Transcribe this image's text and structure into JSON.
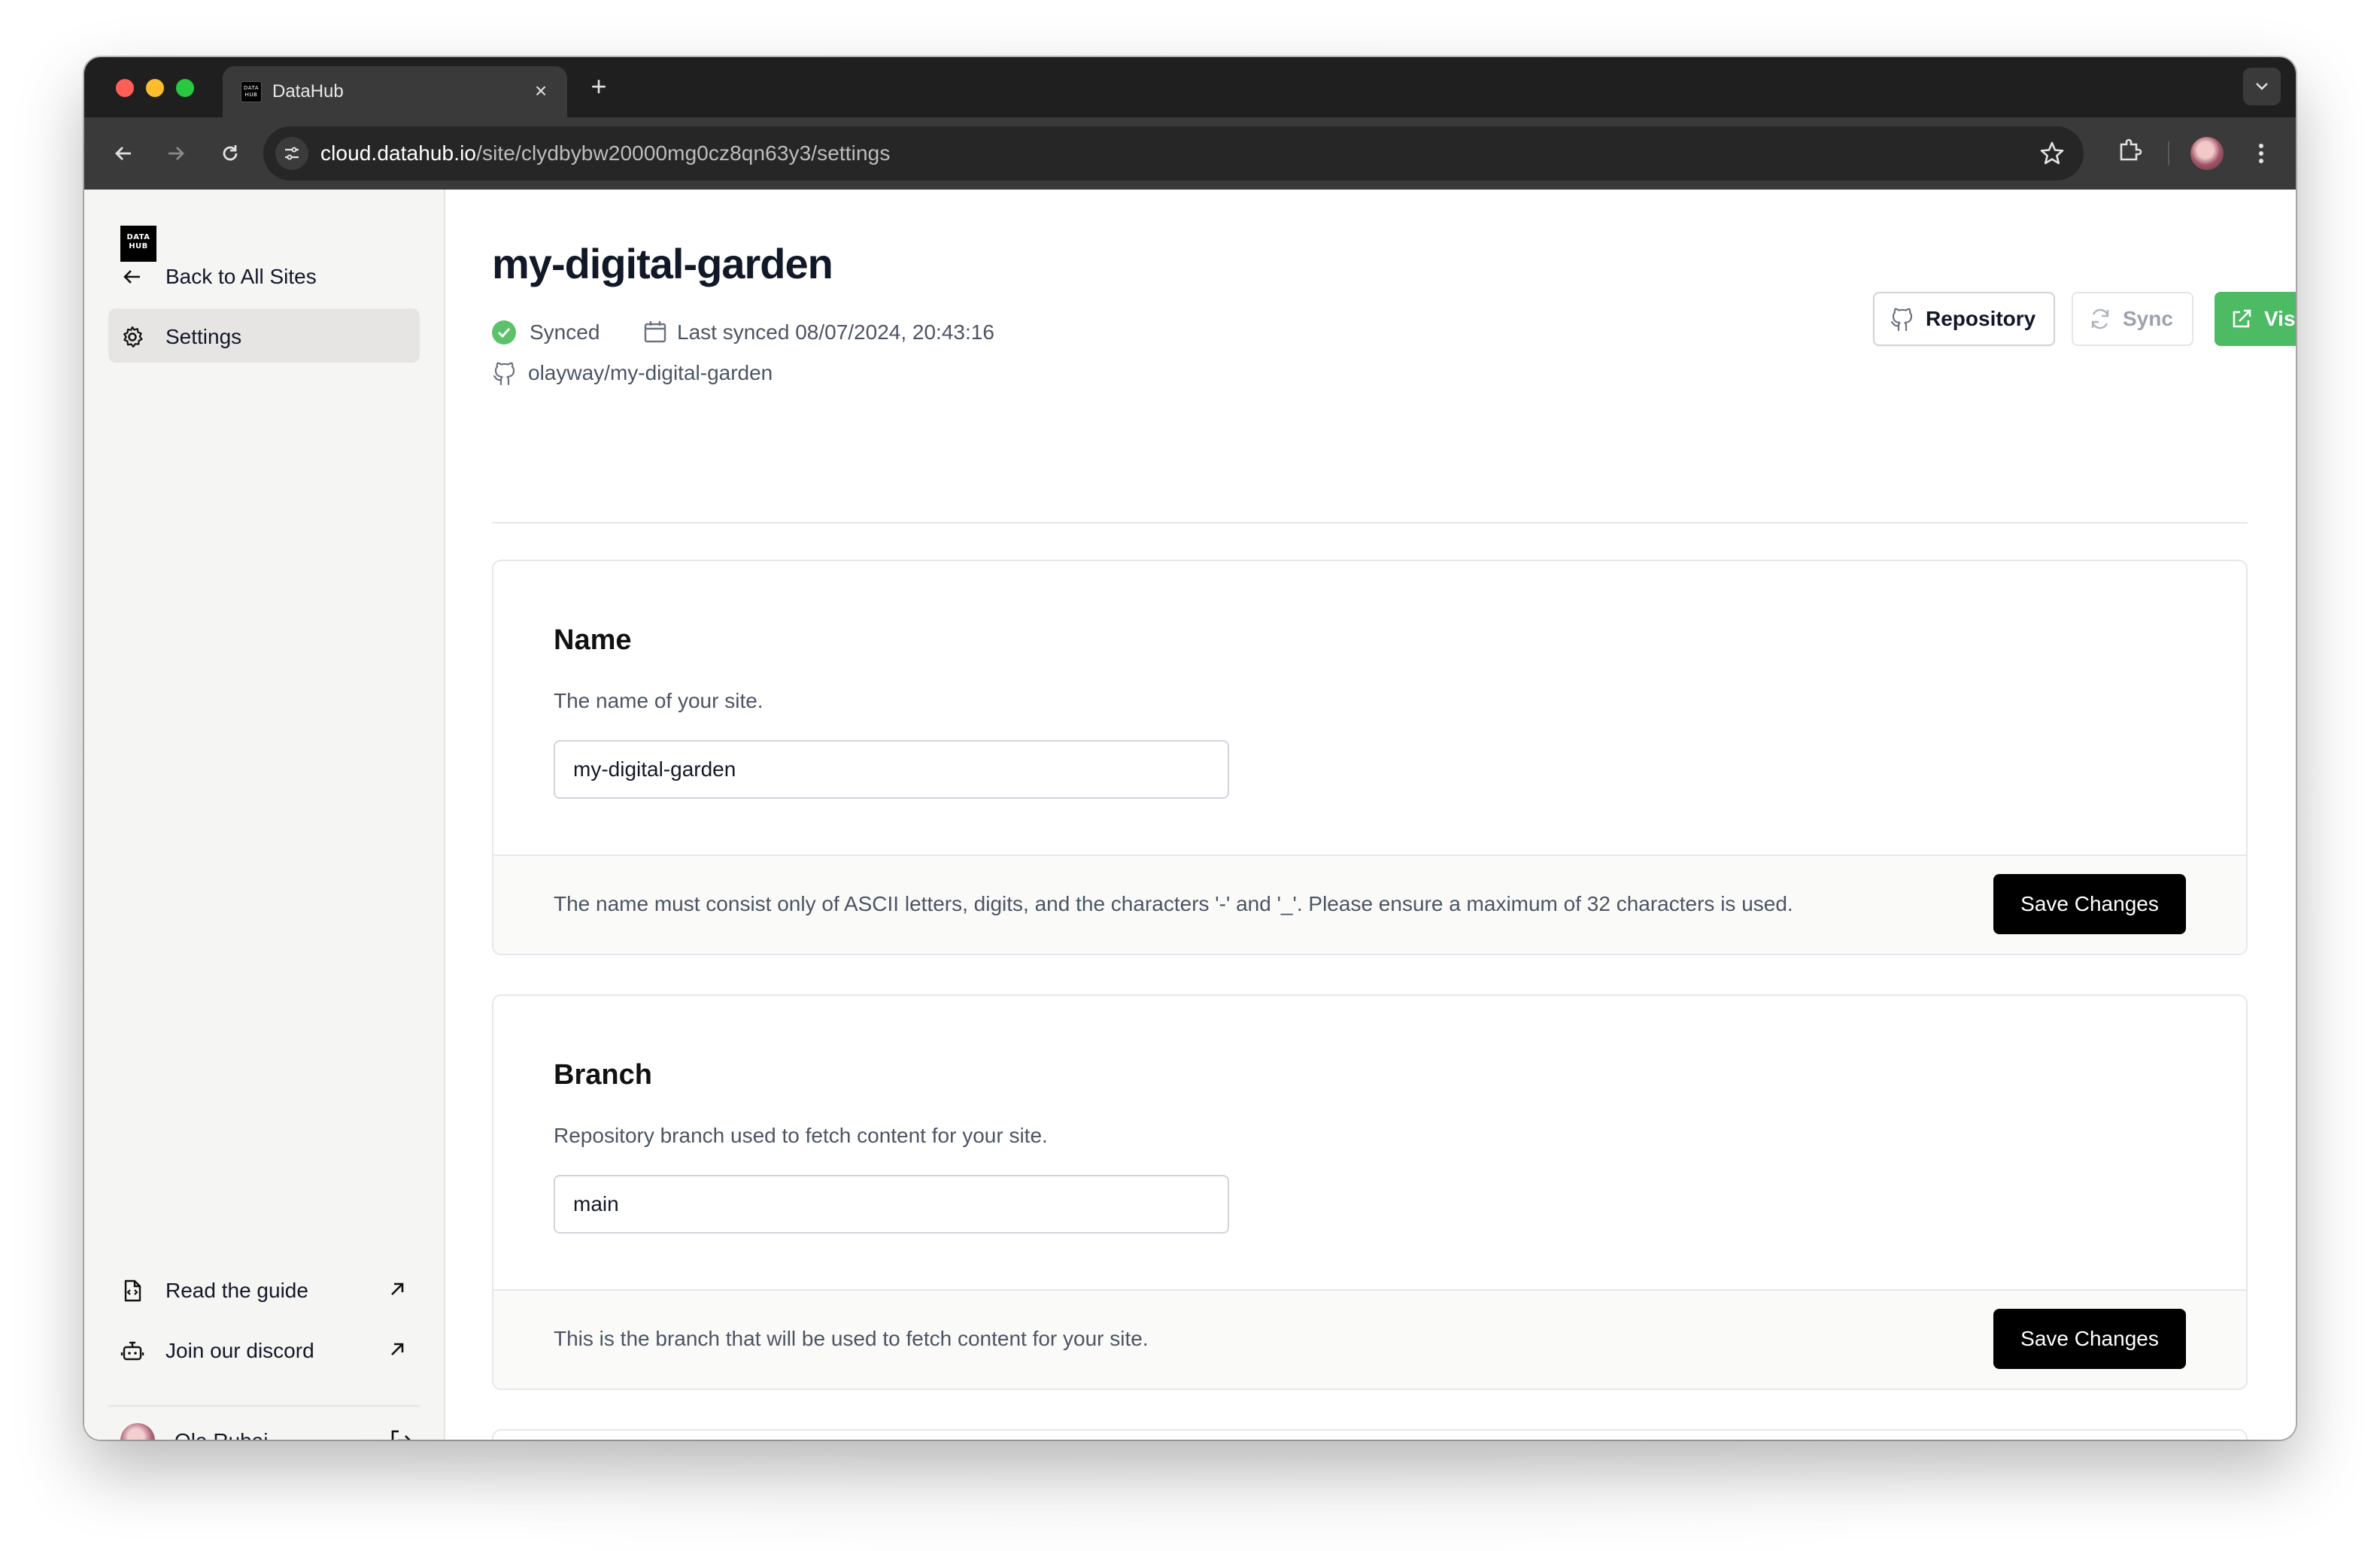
{
  "browser": {
    "tab_title": "DataHub",
    "favicon_text": "DATA HUB",
    "url_domain": "cloud.datahub.io",
    "url_path": "/site/clydbybw20000mg0cz8qn63y3/settings"
  },
  "sidebar": {
    "logo_text": "DATA HUB",
    "back_label": "Back to All Sites",
    "settings_label": "Settings",
    "guide_label": "Read the guide",
    "discord_label": "Join our discord",
    "user_name": "Ola Rubaj"
  },
  "header": {
    "site_title": "my-digital-garden",
    "status": "Synced",
    "last_synced": "Last synced 08/07/2024, 20:43:16",
    "repo": "olayway/my-digital-garden",
    "repository_button": "Repository",
    "sync_button": "Sync",
    "visit_button": "Visit"
  },
  "cards": [
    {
      "title": "Name",
      "description": "The name of your site.",
      "value": "my-digital-garden",
      "footer": "The name must consist only of ASCII letters, digits, and the characters '-' and '_'. Please ensure a maximum of 32 characters is used.",
      "save_label": "Save Changes"
    },
    {
      "title": "Branch",
      "description": "Repository branch used to fetch content for your site.",
      "value": "main",
      "footer": "This is the branch that will be used to fetch content for your site.",
      "save_label": "Save Changes"
    }
  ],
  "colors": {
    "accent_green": "#4cbb64",
    "synced_green": "#5cc26a"
  }
}
